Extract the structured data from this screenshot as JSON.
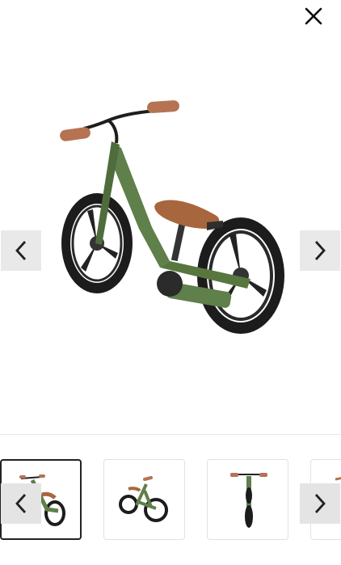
{
  "header": {
    "close_icon": "close-icon"
  },
  "viewer": {
    "prev_icon": "chevron-left-icon",
    "next_icon": "chevron-right-icon",
    "image": "balance-bike-side-view",
    "colors": {
      "frame": "#5f7f4b",
      "seat": "#a8663e",
      "tire": "#1c1c1c",
      "grips": "#b57352"
    }
  },
  "thumbnails": {
    "items": [
      {
        "image": "balance-bike-angle",
        "active": true
      },
      {
        "image": "balance-bike-side",
        "active": false
      },
      {
        "image": "balance-bike-front",
        "active": false
      },
      {
        "image": "balance-bike-partial",
        "active": false
      }
    ],
    "prev_icon": "chevron-left-icon",
    "next_icon": "chevron-right-icon"
  }
}
